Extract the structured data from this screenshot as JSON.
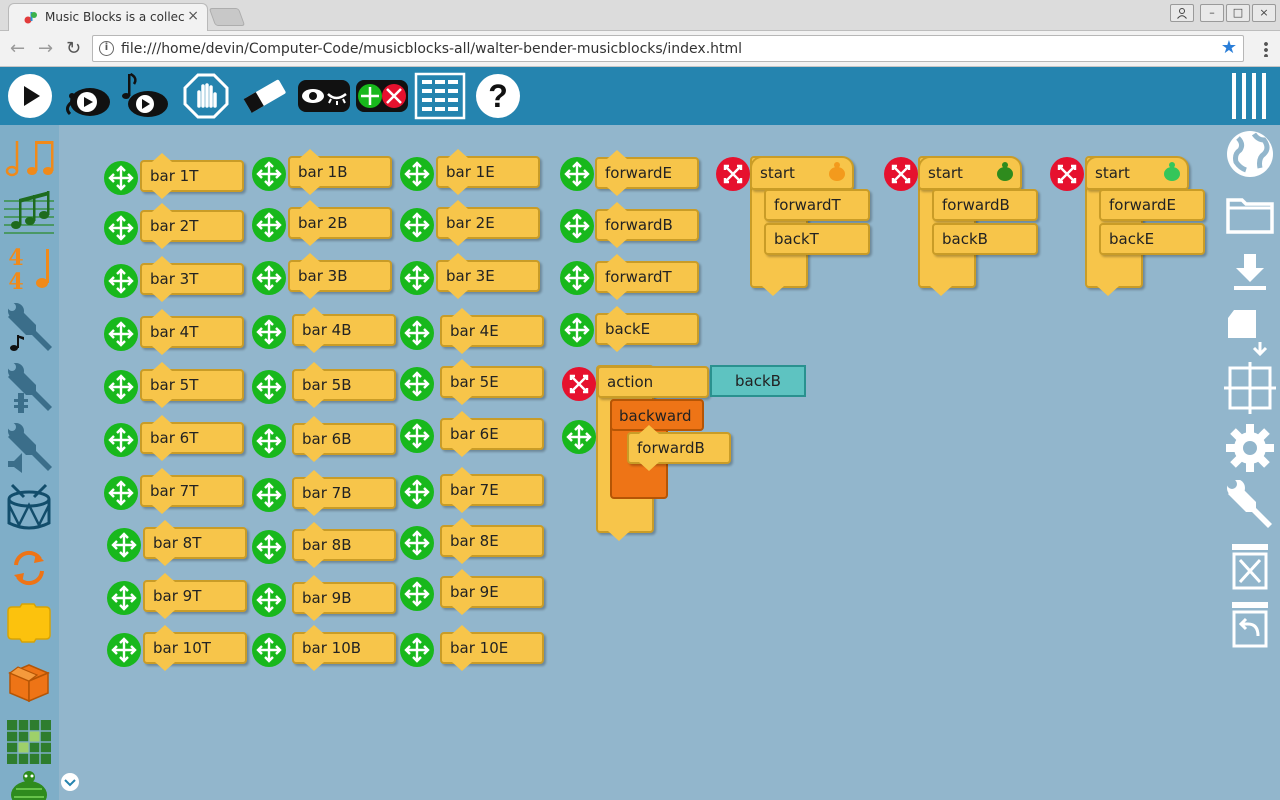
{
  "browser": {
    "tab_title": "Music Blocks is a collection",
    "tab_close": "×",
    "url": "file:///home/devin/Computer-Code/musicblocks-all/walter-bender-musicblocks/index.html",
    "back": "←",
    "forward": "→",
    "reload": "↻",
    "info": "i",
    "star": "★",
    "min": "–",
    "max": "□",
    "close": "×",
    "profile": "👤"
  },
  "top_toolbar": {
    "icons": [
      "play-icon",
      "run-slowly-icon",
      "run-music-slowly-icon",
      "stop-icon",
      "clear-icon",
      "hide-blocks-icon",
      "collapse-blocks-icon",
      "grid-icon",
      "help-icon"
    ]
  },
  "left_palette": {
    "icons": [
      "rhythm-icon",
      "pitch-icon",
      "meter-icon",
      "tone-icon",
      "ornament-icon",
      "volume-icon",
      "drum-icon",
      "flow-icon",
      "action-icon",
      "boxes-icon",
      "widgets-icon",
      "turtle-icon"
    ]
  },
  "right_bar": {
    "icons": [
      "language-icon",
      "open-folder-icon",
      "save-icon",
      "new-file-icon",
      "home-icon",
      "settings-icon",
      "tools-icon",
      "empty-trash-icon",
      "restore-trash-icon"
    ]
  },
  "blocks": {
    "col_t": [
      "bar 1T",
      "bar 2T",
      "bar 3T",
      "bar 4T",
      "bar 5T",
      "bar 6T",
      "bar 7T",
      "bar 8T",
      "bar 9T",
      "bar 10T"
    ],
    "col_b": [
      "bar 1B",
      "bar 2B",
      "bar 3B",
      "bar 4B",
      "bar 5B",
      "bar 6B",
      "bar 7B",
      "bar 8B",
      "bar 9B",
      "bar 10B"
    ],
    "col_e": [
      "bar 1E",
      "bar 2E",
      "bar 3E",
      "bar 4E",
      "bar 5E",
      "bar 6E",
      "bar 7E",
      "bar 8E",
      "bar 9E",
      "bar 10E"
    ],
    "col_fwd": [
      "forwardE",
      "forwardB",
      "forwardT",
      "backE"
    ],
    "action_label": "action",
    "action_arg": "backB",
    "backward_label": "backward",
    "backward_inner": "forwardB",
    "start_blocks": [
      {
        "label": "start",
        "a": "forwardT",
        "b": "backT",
        "turtle_color": "#f39a1c"
      },
      {
        "label": "start",
        "a": "forwardB",
        "b": "backB",
        "turtle_color": "#2e8b1d"
      },
      {
        "label": "start",
        "a": "forwardE",
        "b": "backE",
        "turtle_color": "#35c65a"
      }
    ]
  },
  "colors": {
    "topbar": "#2584af",
    "palette": "#7faec8",
    "canvas": "#92b6cc",
    "block": "#f7c54a",
    "action_arg": "#5ec3c1",
    "flow": "#ee7416"
  }
}
